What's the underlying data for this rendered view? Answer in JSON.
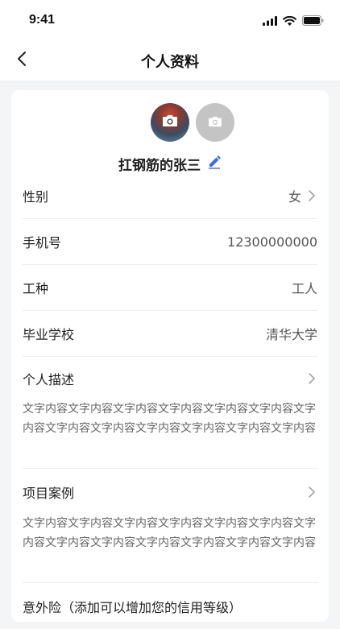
{
  "status_bar": {
    "time": "9:41"
  },
  "nav": {
    "title": "个人资料"
  },
  "profile": {
    "name": "扛钢筋的张三"
  },
  "fields": [
    {
      "label": "性别",
      "value": "女",
      "has_chevron": true
    },
    {
      "label": "手机号",
      "value": "12300000000",
      "has_chevron": false
    },
    {
      "label": "工种",
      "value": "工人",
      "has_chevron": false
    },
    {
      "label": "毕业学校",
      "value": "清华大学",
      "has_chevron": false
    }
  ],
  "sections": [
    {
      "label": "个人描述",
      "text": "文字内容文字内容文字内容文字内容文字内容文字内容文字内容文字内容文字内容文字内容文字内容文字内容文字内容"
    },
    {
      "label": "项目案例",
      "text": "文字内容文字内容文字内容文字内容文字内容文字内容文字内容文字内容文字内容文字内容文字内容文字内容文字内容"
    },
    {
      "label": "意外险（添加可以增加您的信用等级）"
    }
  ],
  "colors": {
    "accent": "#3a6fd8",
    "background": "#f4f5f7",
    "card": "#ffffff",
    "avatar_placeholder": "#c4c4c4"
  },
  "icons": [
    "back-chevron-icon",
    "camera-icon",
    "edit-pencil-icon",
    "chevron-right-icon",
    "signal-icon",
    "wifi-icon",
    "battery-icon"
  ]
}
